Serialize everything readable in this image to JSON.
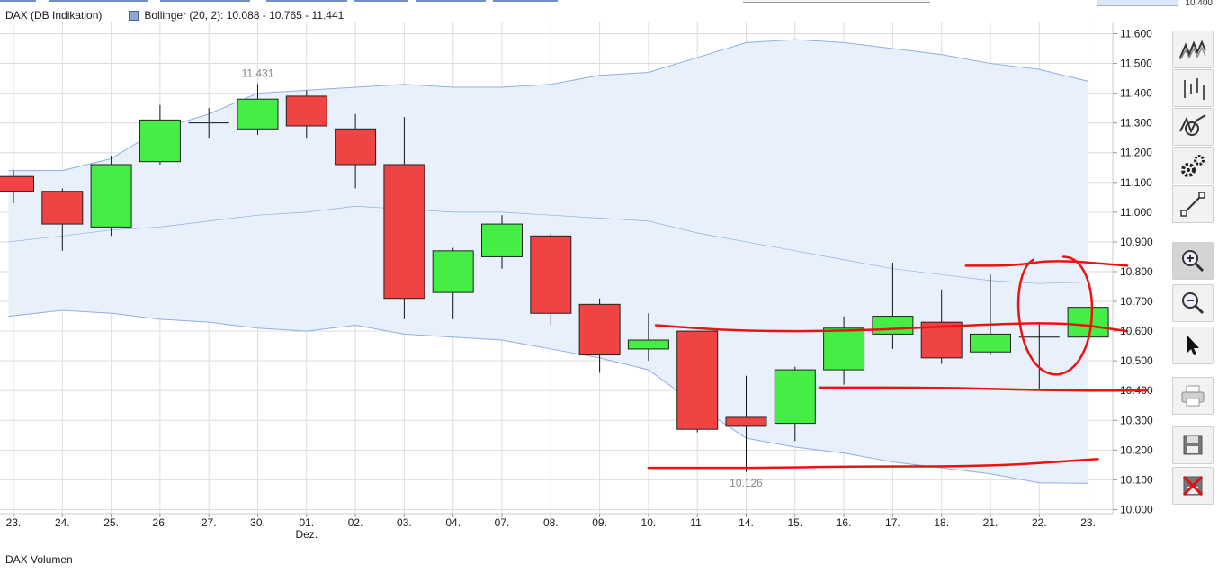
{
  "header": {
    "instrument_label": "DAX (DB Indikation)",
    "indicator_label": "Bollinger (20, 2): 10.088 - 10.765 - 11.441",
    "corner_value": "10.400"
  },
  "footer": {
    "volume_label": "DAX Volumen"
  },
  "colors": {
    "up": "#44ee44",
    "down": "#f04444",
    "band_fill": "#e8f0fb",
    "band_line": "#90aee0",
    "grid": "#dddddd",
    "annotation": "#ee1111"
  },
  "toolbar": {
    "buttons": [
      {
        "name": "line-chart-button",
        "icon": "line-chart-icon"
      },
      {
        "name": "ohlc-chart-button",
        "icon": "ohlc-chart-icon"
      },
      {
        "name": "indicator-button",
        "icon": "indicator-icon"
      },
      {
        "name": "settings-button",
        "icon": "gears-icon"
      },
      {
        "name": "draw-line-button",
        "icon": "line-tool-icon"
      },
      {
        "name": "zoom-in-button",
        "icon": "zoom-in-icon"
      },
      {
        "name": "zoom-out-button",
        "icon": "zoom-out-icon"
      },
      {
        "name": "pointer-button",
        "icon": "cursor-icon"
      },
      {
        "name": "print-button",
        "icon": "printer-icon"
      },
      {
        "name": "save-button",
        "icon": "floppy-disk-icon"
      },
      {
        "name": "delete-button",
        "icon": "delete-icon"
      }
    ]
  },
  "chart_data": {
    "type": "candlestick",
    "ylim": [
      9.93,
      11.65
    ],
    "yticks": [
      "10.000",
      "10.100",
      "10.200",
      "10.300",
      "10.400",
      "10.500",
      "10.600",
      "10.700",
      "10.800",
      "10.900",
      "11.000",
      "11.100",
      "11.200",
      "11.300",
      "11.400",
      "11.500",
      "11.600"
    ],
    "categories": [
      "23.",
      "24.",
      "25.",
      "26.",
      "27.",
      "30.",
      "01.",
      "02.",
      "03.",
      "04.",
      "07.",
      "08.",
      "09.",
      "10.",
      "11.",
      "14.",
      "15.",
      "16.",
      "17.",
      "18.",
      "21.",
      "22.",
      "23."
    ],
    "category_sublabels": {
      "6": "Dez."
    },
    "candles": [
      {
        "o": 11.12,
        "h": 11.14,
        "l": 11.03,
        "c": 11.07
      },
      {
        "o": 11.07,
        "h": 11.08,
        "l": 10.87,
        "c": 10.96
      },
      {
        "o": 10.95,
        "h": 11.19,
        "l": 10.92,
        "c": 11.16
      },
      {
        "o": 11.17,
        "h": 11.36,
        "l": 11.16,
        "c": 11.31
      },
      {
        "o": 11.3,
        "h": 11.35,
        "l": 11.25,
        "c": 11.3
      },
      {
        "o": 11.28,
        "h": 11.431,
        "l": 11.26,
        "c": 11.38
      },
      {
        "o": 11.39,
        "h": 11.41,
        "l": 11.25,
        "c": 11.29
      },
      {
        "o": 11.28,
        "h": 11.33,
        "l": 11.08,
        "c": 11.16
      },
      {
        "o": 11.16,
        "h": 11.32,
        "l": 10.64,
        "c": 10.71
      },
      {
        "o": 10.73,
        "h": 10.88,
        "l": 10.64,
        "c": 10.87
      },
      {
        "o": 10.85,
        "h": 10.99,
        "l": 10.81,
        "c": 10.96
      },
      {
        "o": 10.92,
        "h": 10.93,
        "l": 10.62,
        "c": 10.66
      },
      {
        "o": 10.69,
        "h": 10.71,
        "l": 10.46,
        "c": 10.52
      },
      {
        "o": 10.54,
        "h": 10.66,
        "l": 10.5,
        "c": 10.57
      },
      {
        "o": 10.6,
        "h": 10.6,
        "l": 10.26,
        "c": 10.27
      },
      {
        "o": 10.31,
        "h": 10.45,
        "l": 10.126,
        "c": 10.28
      },
      {
        "o": 10.29,
        "h": 10.48,
        "l": 10.23,
        "c": 10.47
      },
      {
        "o": 10.47,
        "h": 10.65,
        "l": 10.42,
        "c": 10.61
      },
      {
        "o": 10.59,
        "h": 10.83,
        "l": 10.54,
        "c": 10.65
      },
      {
        "o": 10.63,
        "h": 10.74,
        "l": 10.49,
        "c": 10.51
      },
      {
        "o": 10.53,
        "h": 10.79,
        "l": 10.52,
        "c": 10.59
      },
      {
        "o": 10.58,
        "h": 10.63,
        "l": 10.4,
        "c": 10.58
      },
      {
        "o": 10.58,
        "h": 10.69,
        "l": 10.56,
        "c": 10.68
      }
    ],
    "bollinger": {
      "x": [
        -0.1,
        1,
        2,
        3,
        4,
        5,
        6,
        7,
        8,
        9,
        10,
        11,
        12,
        13,
        14,
        15,
        16,
        17,
        18,
        19,
        20,
        21,
        22
      ],
      "upper": [
        11.14,
        11.14,
        11.18,
        11.28,
        11.33,
        11.4,
        11.41,
        11.42,
        11.43,
        11.42,
        11.42,
        11.43,
        11.46,
        11.47,
        11.52,
        11.57,
        11.58,
        11.57,
        11.55,
        11.53,
        11.5,
        11.48,
        11.44
      ],
      "middle": [
        10.9,
        10.92,
        10.94,
        10.95,
        10.97,
        10.99,
        11.0,
        11.02,
        11.01,
        11.0,
        11.0,
        10.99,
        10.98,
        10.97,
        10.93,
        10.9,
        10.87,
        10.84,
        10.81,
        10.79,
        10.77,
        10.76,
        10.765
      ],
      "lower": [
        10.65,
        10.67,
        10.66,
        10.64,
        10.63,
        10.61,
        10.6,
        10.62,
        10.59,
        10.58,
        10.57,
        10.54,
        10.51,
        10.47,
        10.35,
        10.24,
        10.21,
        10.19,
        10.16,
        10.14,
        10.12,
        10.09,
        10.088
      ]
    },
    "annotations": [
      {
        "text": "11.431",
        "candle": 5,
        "at": "high"
      },
      {
        "text": "10.126",
        "candle": 15,
        "at": "low"
      }
    ],
    "drawn_marks": [
      {
        "kind": "line",
        "points": [
          [
            13.15,
            10.62
          ],
          [
            14.8,
            10.6
          ],
          [
            17.2,
            10.6
          ],
          [
            19.5,
            10.62
          ],
          [
            21.5,
            10.63
          ],
          [
            22.8,
            10.6
          ]
        ]
      },
      {
        "kind": "line",
        "points": [
          [
            16.5,
            10.41
          ],
          [
            19.0,
            10.41
          ],
          [
            21.5,
            10.4
          ],
          [
            23.2,
            10.4
          ]
        ]
      },
      {
        "kind": "line",
        "points": [
          [
            13.0,
            10.14
          ],
          [
            15.5,
            10.14
          ],
          [
            17.0,
            10.145
          ],
          [
            20.0,
            10.145
          ],
          [
            22.2,
            10.17
          ]
        ]
      },
      {
        "kind": "line",
        "points": [
          [
            19.5,
            10.82
          ],
          [
            20.5,
            10.82
          ],
          [
            21.3,
            10.84
          ],
          [
            22.8,
            10.82
          ]
        ]
      },
      {
        "kind": "ellipse",
        "cx": 21.33,
        "cy": 10.65,
        "rx": 0.82,
        "ry": 0.2
      }
    ]
  }
}
